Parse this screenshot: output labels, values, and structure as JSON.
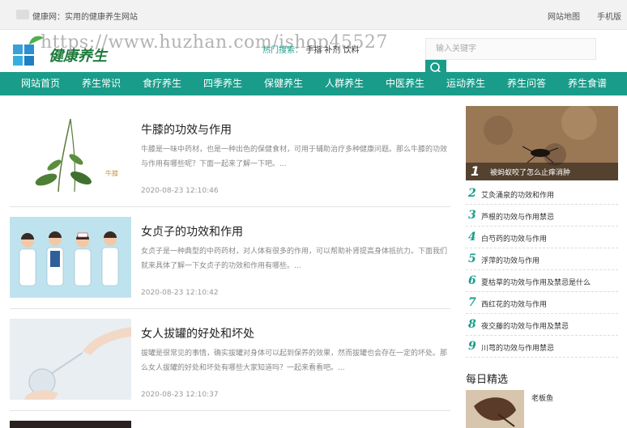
{
  "topbar": {
    "welcome": "健康网：实用的健康养生网站",
    "map": "网站地图",
    "mobile": "手机版"
  },
  "header": {
    "logo_text": "健康养生",
    "watermark": "https://www.huzhan.com/ishop45527",
    "hot_label": "热门搜索：",
    "hot_keywords": "手指 补剂 饮料",
    "search_placeholder": "输入关键字"
  },
  "nav": {
    "items": [
      "网站首页",
      "养生常识",
      "食疗养生",
      "四季养生",
      "保健养生",
      "人群养生",
      "中医养生",
      "运动养生",
      "养生问答",
      "养生食谱"
    ]
  },
  "articles": [
    {
      "title": "牛膝的功效与作用",
      "desc": "牛膝是一味中药材，也是一种出色的保健食材，可用于辅助治疗多种健康问题。那么牛膝的功效与作用有哪些呢？下面一起来了解一下吧。...",
      "date": "2020-08-23 12:10:46"
    },
    {
      "title": "女贞子的功效和作用",
      "desc": "女贞子是一种典型的中药药材，对人体有很多的作用，可以帮助补肾提高身体抵抗力。下面我们就来具体了解一下女贞子的功效和作用有哪些。...",
      "date": "2020-08-23 12:10:42"
    },
    {
      "title": "女人拔罐的好处和坏处",
      "desc": "拔罐是很常见的事情，确实拔罐对身体可以起到保养的效果，然而拔罐也会存在一定的坏处。那么女人拔罐的好处和坏处有哪些大家知道吗？一起来看看吧。...",
      "date": "2020-08-23 12:10:37"
    }
  ],
  "sidebar": {
    "featured": {
      "num": "1",
      "title": "被蚂蚁咬了怎么止痒消肿"
    },
    "ranks": [
      {
        "num": "2",
        "title": "艾灸涌泉的功效和作用"
      },
      {
        "num": "3",
        "title": "芦根的功效与作用禁忌"
      },
      {
        "num": "4",
        "title": "白芍药的功效与作用"
      },
      {
        "num": "5",
        "title": "浮萍的功效与作用"
      },
      {
        "num": "6",
        "title": "夏枯草的功效与作用及禁忌是什么"
      },
      {
        "num": "7",
        "title": "西红花的功效与作用"
      },
      {
        "num": "8",
        "title": "夜交藤的功效与作用及禁忌"
      },
      {
        "num": "9",
        "title": "川芎的功效与作用禁忌"
      }
    ],
    "daily_title": "每日精选",
    "daily_item": "老板鱼"
  },
  "colors": {
    "accent": "#1a9c8a"
  }
}
